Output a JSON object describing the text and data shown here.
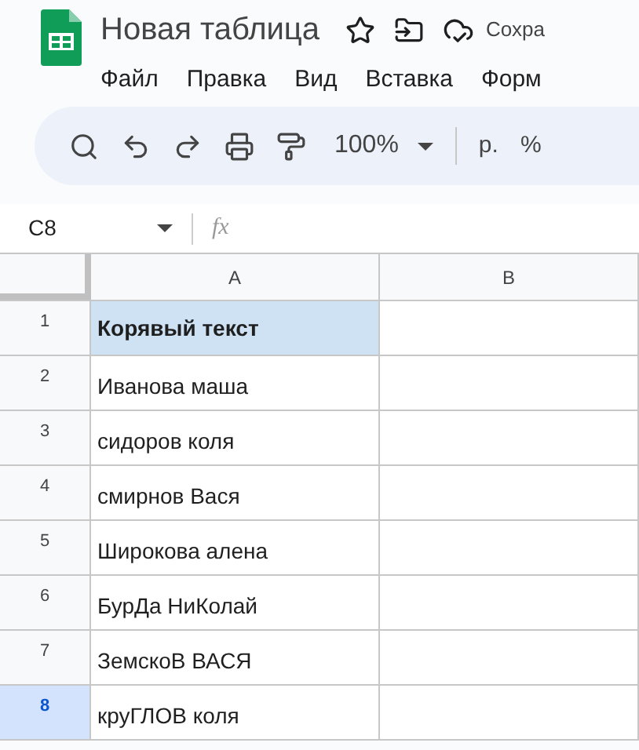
{
  "app": {
    "title": "Новая таблица",
    "save_status": "Сохра"
  },
  "menu": [
    "Файл",
    "Правка",
    "Вид",
    "Вставка",
    "Форм"
  ],
  "toolbar": {
    "zoom": "100%",
    "currency": "р.",
    "percent": "%"
  },
  "formula_bar": {
    "cell_ref": "C8",
    "fx": "fx"
  },
  "columns": [
    {
      "label": "A"
    },
    {
      "label": "B"
    }
  ],
  "rows": [
    {
      "number": "1",
      "cells": [
        "Корявый текст",
        ""
      ],
      "header": true,
      "selected": false
    },
    {
      "number": "2",
      "cells": [
        "Иванова маша",
        ""
      ],
      "header": false,
      "selected": false
    },
    {
      "number": "3",
      "cells": [
        "сидоров коля",
        ""
      ],
      "header": false,
      "selected": false
    },
    {
      "number": "4",
      "cells": [
        "смирнов Вася",
        ""
      ],
      "header": false,
      "selected": false
    },
    {
      "number": "5",
      "cells": [
        "Широкова алена",
        ""
      ],
      "header": false,
      "selected": false
    },
    {
      "number": "6",
      "cells": [
        "БурДа НиКолай",
        ""
      ],
      "header": false,
      "selected": false
    },
    {
      "number": "7",
      "cells": [
        "ЗемскоВ ВАСЯ",
        ""
      ],
      "header": false,
      "selected": false
    },
    {
      "number": "8",
      "cells": [
        "круГЛОВ коля",
        ""
      ],
      "header": false,
      "selected": true
    }
  ]
}
